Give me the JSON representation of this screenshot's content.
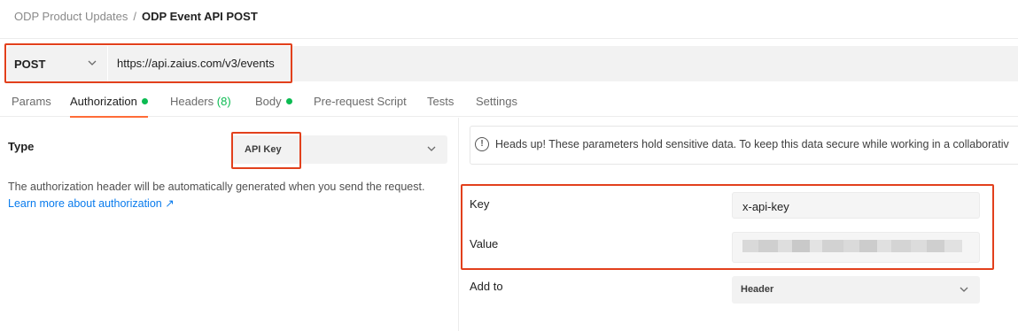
{
  "breadcrumb": {
    "parent": "ODP Product Updates",
    "separator": "/",
    "current": "ODP Event API POST"
  },
  "request": {
    "method": "POST",
    "url": "https://api.zaius.com/v3/events"
  },
  "tabs": [
    {
      "label": "Params"
    },
    {
      "label": "Authorization",
      "dot": true
    },
    {
      "label": "Headers",
      "count": "(8)"
    },
    {
      "label": "Body",
      "dot": true
    },
    {
      "label": "Pre-request Script"
    },
    {
      "label": "Tests"
    },
    {
      "label": "Settings"
    }
  ],
  "active_tab": "Authorization",
  "auth": {
    "type_label": "Type",
    "type_value": "API Key",
    "description": "The authorization header will be automatically generated when you send the request.",
    "learn_more": "Learn more about authorization ↗"
  },
  "notice": {
    "icon": "info-icon",
    "text": "Heads up! These parameters hold sensitive data. To keep this data secure while working in a collaborativ"
  },
  "fields": {
    "key_label": "Key",
    "key_value": "x-api-key",
    "value_label": "Value",
    "value_redacted": true,
    "add_to_label": "Add to",
    "add_to_value": "Header"
  },
  "colors": {
    "highlight": "#e2401c",
    "active_tab_underline": "#ff6c37",
    "status_dot": "#0cbb52",
    "link": "#097bed"
  }
}
